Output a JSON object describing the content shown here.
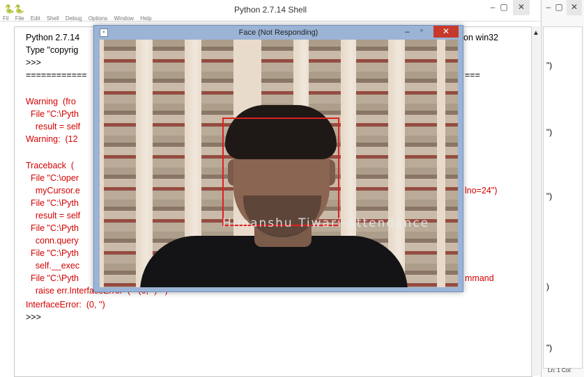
{
  "shell": {
    "title": "Python 2.7.14 Shell",
    "menu": [
      "File",
      "Edit",
      "Shell",
      "Debug",
      "Options",
      "Window",
      "Help"
    ],
    "lines": [
      {
        "text": "Python 2.7.14",
        "color": "black"
      },
      {
        "text": "Type \"copyrig",
        "color": "black"
      },
      {
        "text": ">>>",
        "color": "black"
      },
      {
        "text": "============",
        "color": "black"
      },
      {
        "text": "Warning  (fro",
        "color": "red"
      },
      {
        "text": "  File \"C:\\Pyth",
        "color": "red"
      },
      {
        "text": "    result = self",
        "color": "red"
      },
      {
        "text": "Warning:  (12",
        "color": "red"
      },
      {
        "text": "Traceback  (",
        "color": "red"
      },
      {
        "text": "  File \"C:\\oper",
        "color": "red"
      },
      {
        "text": "    myCursor.e",
        "color": "red"
      },
      {
        "text": "  File \"C:\\Pyth",
        "color": "red"
      },
      {
        "text": "    result = self",
        "color": "red"
      },
      {
        "text": "  File \"C:\\Pyth",
        "color": "red"
      },
      {
        "text": "    conn.query",
        "color": "red"
      },
      {
        "text": "  File \"C:\\Pyth",
        "color": "red"
      },
      {
        "text": "    self.__exec",
        "color": "red"
      },
      {
        "text": "  File \"C:\\Pyth",
        "color": "red"
      },
      {
        "text": "    raise err.InterfaceError  (\"  (0, '')  \")",
        "color": "red"
      },
      {
        "text": "InterfaceError:  (0, '')",
        "color": "red"
      },
      {
        "text": ">>>",
        "color": "black"
      }
    ],
    "right_fragments": {
      "win32": ")  ] on win32",
      "eq": "===",
      "lino": "lno=24\")",
      "command": "mmand"
    }
  },
  "right_window": {
    "fragments": [
      "\")",
      "\")",
      "\")",
      ")",
      "\")"
    ],
    "status": "Ln: 1  Col:"
  },
  "face_window": {
    "title": "Face (Not Responding)",
    "overlay_label": "Himanshu Tiwari-Attendance"
  },
  "icons": {
    "minimize": "minimize-icon",
    "maximize": "maximize-icon",
    "close": "close-icon",
    "python": "python-icon"
  }
}
